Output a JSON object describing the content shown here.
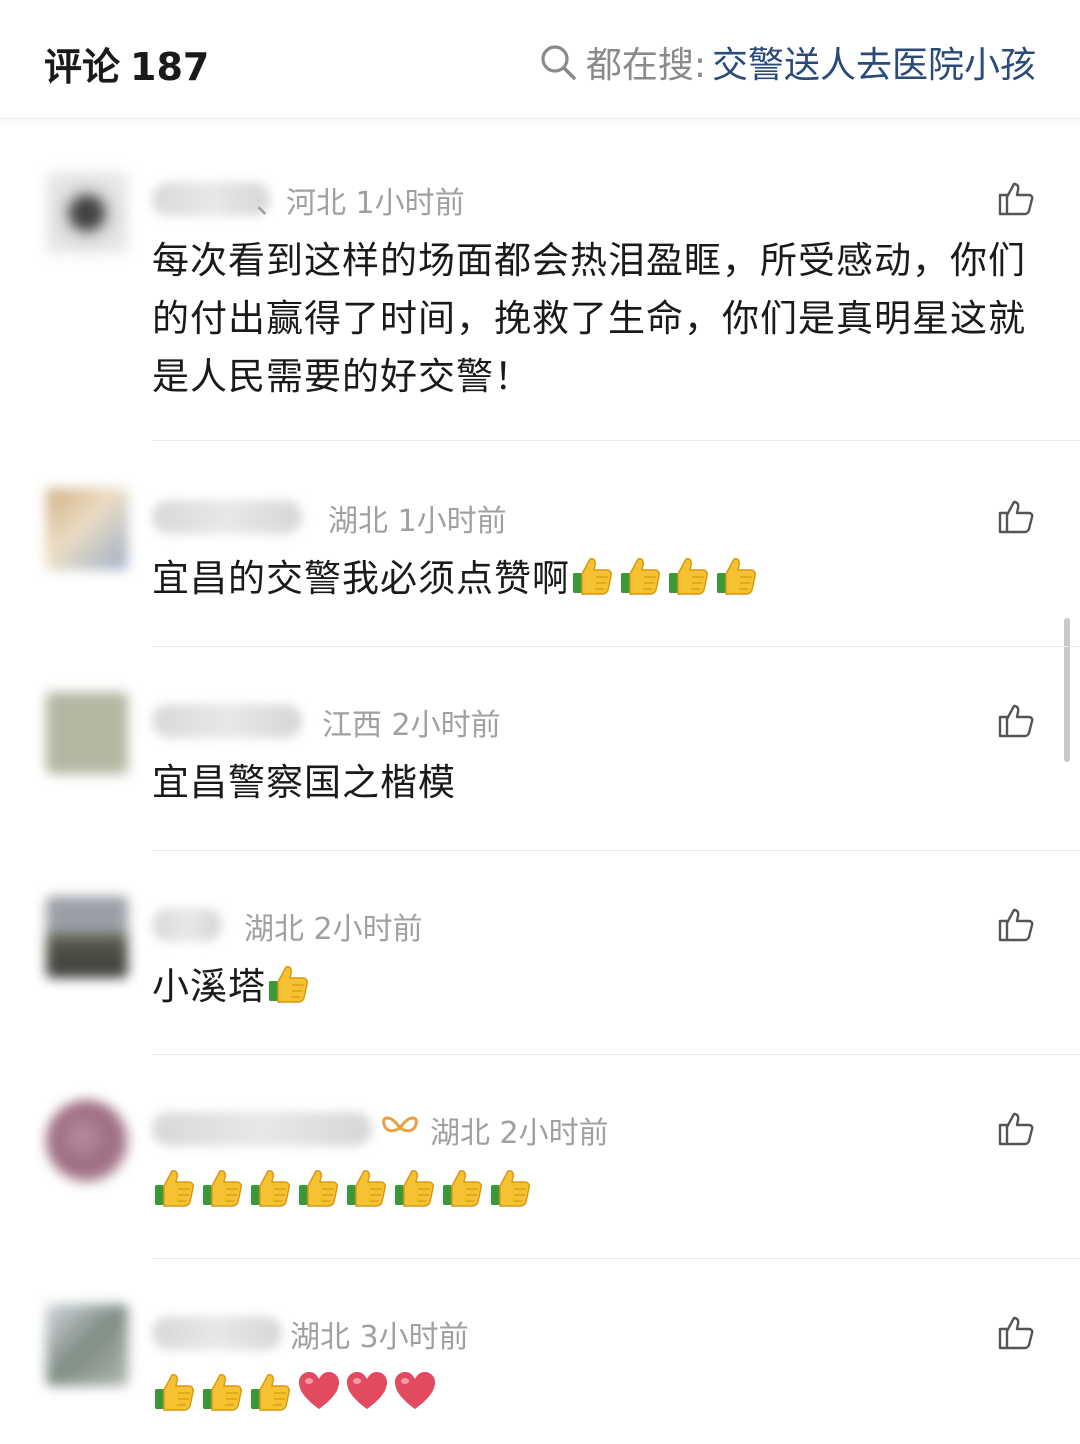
{
  "header": {
    "title": "评论",
    "count": "187",
    "search_prefix": "都在搜:",
    "search_term": "交警送人去医院小孩"
  },
  "comments": [
    {
      "meta": "、河北 1小时前",
      "text": "每次看到这样的场面都会热泪盈眶，所受感动，你们的付出赢得了时间，挽救了生命，你们是真明星这就是人民需要的好交警！",
      "emoji_count": 0,
      "avatar_color": "#6a6a6a"
    },
    {
      "meta": "湖北 1小时前",
      "text": "宜昌的交警我必须点赞啊",
      "emoji_count": 4,
      "avatar_color": "#b08a6a"
    },
    {
      "meta": "江西 2小时前",
      "text": "宜昌警察国之楷模",
      "emoji_count": 0,
      "avatar_color": "#9aa088"
    },
    {
      "meta": "湖北 2小时前",
      "text": "小溪塔",
      "emoji_count": 1,
      "avatar_color": "#3a3a3a"
    },
    {
      "meta": "湖北 2小时前",
      "text": "",
      "emoji_count": 8,
      "avatar_color": "#a06a80"
    },
    {
      "meta": "湖北 3小时前",
      "text": "",
      "emoji_count": 3,
      "heart_count": 3,
      "avatar_color": "#7a8a80"
    }
  ],
  "icons": {
    "search": "search-icon",
    "like": "thumbs-up-outline-icon",
    "emoji": "thumbs-up-emoji-icon",
    "heart": "heart-emoji-icon",
    "badge": "infinity-badge-icon"
  },
  "colors": {
    "search_term": "#2a4a7a",
    "meta_text": "#a0a0a0"
  }
}
